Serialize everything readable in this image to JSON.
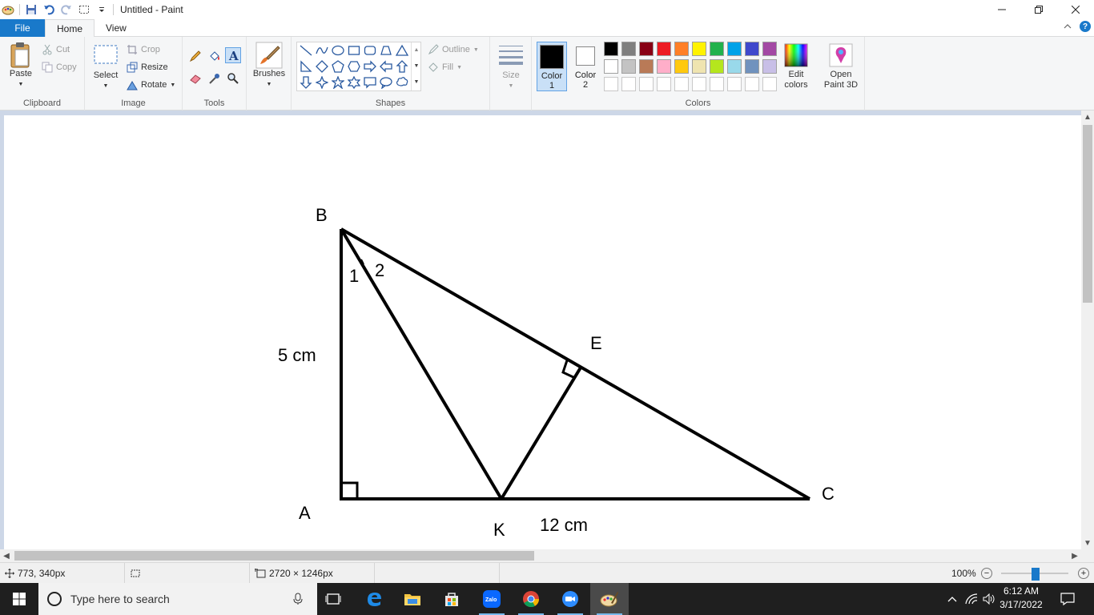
{
  "window": {
    "title": "Untitled - Paint"
  },
  "tabs": [
    {
      "label": "File"
    },
    {
      "label": "Home"
    },
    {
      "label": "View"
    }
  ],
  "clipboard": {
    "paste": "Paste",
    "cut": "Cut",
    "copy": "Copy",
    "label": "Clipboard"
  },
  "image": {
    "select": "Select",
    "crop": "Crop",
    "resize": "Resize",
    "rotate": "Rotate",
    "label": "Image"
  },
  "tools": {
    "label": "Tools"
  },
  "brushes": {
    "label": "Brushes"
  },
  "shapes": {
    "outline": "Outline",
    "fill": "Fill",
    "label": "Shapes"
  },
  "size": {
    "label": "Size"
  },
  "colors": {
    "color1": "Color 1",
    "color2": "Color 2",
    "edit": "Edit colors",
    "label": "Colors",
    "color1_value": "#000000",
    "color2_value": "#ffffff",
    "palette_row1": [
      "#000000",
      "#7f7f7f",
      "#880015",
      "#ed1c24",
      "#ff7f27",
      "#fff200",
      "#22b14c",
      "#00a2e8",
      "#3f48cc",
      "#a349a4"
    ],
    "palette_row2": [
      "#ffffff",
      "#c3c3c3",
      "#b97a57",
      "#ffaec9",
      "#ffc90e",
      "#efe4b0",
      "#b5e61d",
      "#99d9ea",
      "#7092be",
      "#c8bfe7"
    ]
  },
  "paint3d": {
    "label": "Open Paint 3D"
  },
  "drawing": {
    "B": "B",
    "A": "A",
    "C": "C",
    "E": "E",
    "K": "K",
    "angle1": "1",
    "angle2": "2",
    "side_ab": "5 cm",
    "side_ac": "12 cm"
  },
  "status": {
    "cursor": "773, 340px",
    "image_size": "2720 × 1246px",
    "zoom": "100%"
  },
  "taskbar": {
    "search_placeholder": "Type here to search",
    "time": "6:12 AM",
    "date": "3/17/2022"
  }
}
